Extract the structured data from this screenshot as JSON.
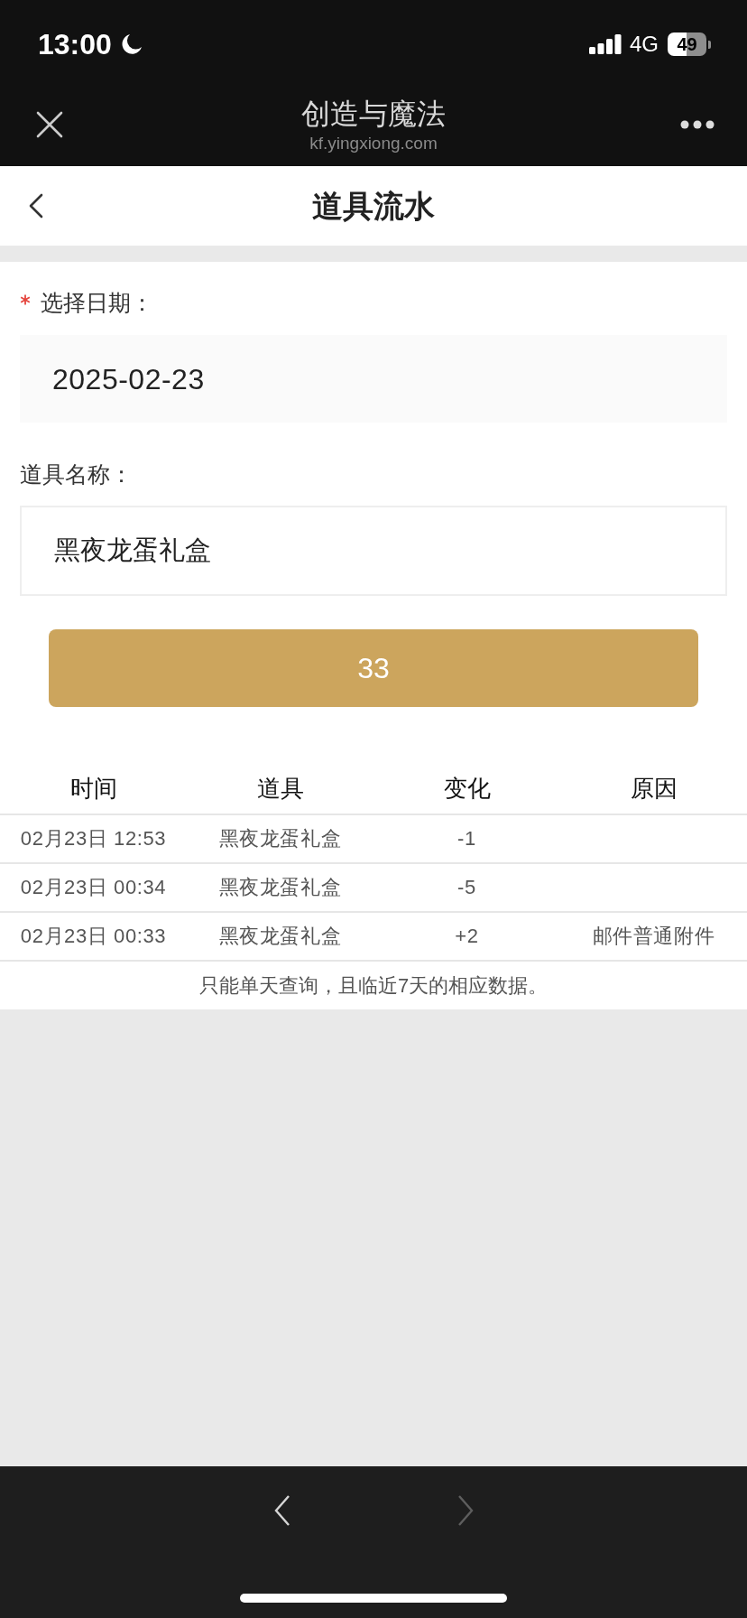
{
  "status_bar": {
    "time": "13:00",
    "network": "4G",
    "battery": "49"
  },
  "browser_bar": {
    "title": "创造与魔法",
    "url": "kf.yingxiong.com"
  },
  "page_header": {
    "title": "道具流水"
  },
  "form": {
    "fields": [
      {
        "kind": "date",
        "label": "选择日期：",
        "required": true,
        "value": "2025-02-23"
      },
      {
        "kind": "text",
        "label": "道具名称：",
        "required": false,
        "value": "黑夜龙蛋礼盒"
      }
    ],
    "submit_button": "33"
  },
  "table": {
    "columns": [
      "时间",
      "道具",
      "变化",
      "原因"
    ],
    "rows": [
      {
        "time": "02月23日 12:53",
        "item": "黑夜龙蛋礼盒",
        "change": "-1"
      },
      {
        "time": "02月23日 00:34",
        "item": "黑夜龙蛋礼盒",
        "change": "-5"
      },
      {
        "time": "02月23日 00:33",
        "item": "黑夜龙蛋礼盒",
        "change": "+2",
        "reason": "邮件普通附件"
      }
    ],
    "note": "只能单天查询，且临近7天的相应数据。"
  },
  "bottom_toolbar": {
    "buttons": [
      {
        "kind": "back",
        "disabled": false
      },
      {
        "kind": "forward",
        "disabled": true
      }
    ]
  }
}
